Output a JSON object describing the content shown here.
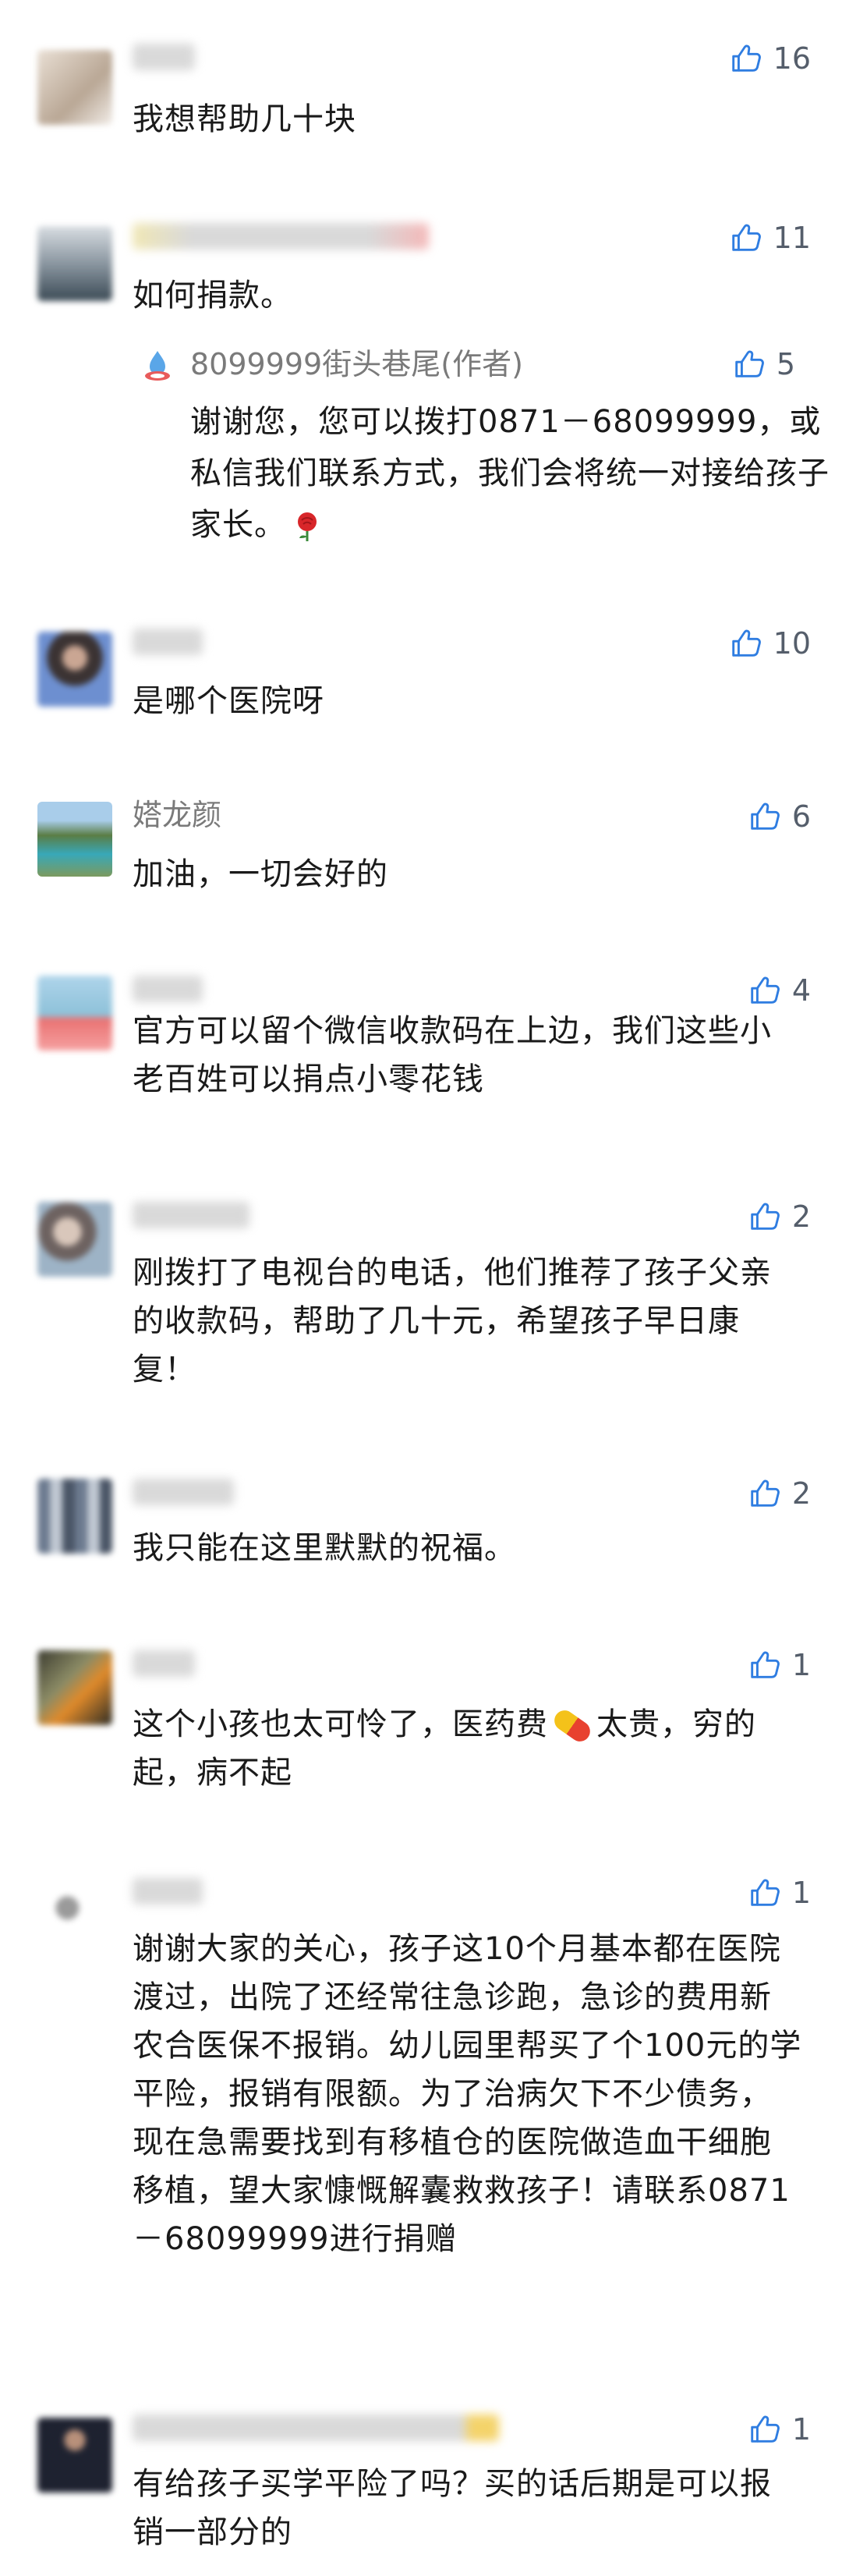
{
  "comments": [
    {
      "text": "我想帮助几十块",
      "likes": "16"
    },
    {
      "text": "如何捐款。",
      "likes": "11",
      "reply": {
        "author": "8099999街头巷尾(作者)",
        "likes": "5",
        "text": "谢谢您，您可以拨打0871－68099999，或私信我们联系方式，我们会将统一对接给孩子家长。",
        "emoji": "rose"
      }
    },
    {
      "text": "是哪个医院呀",
      "likes": "10"
    },
    {
      "nickname": "㜓龙颜",
      "text": "加油，一切会好的",
      "likes": "6"
    },
    {
      "text": "官方可以留个微信收款码在上边，我们这些小老百姓可以捐点小零花钱",
      "likes": "4"
    },
    {
      "text": "刚拨打了电视台的电话，他们推荐了孩子父亲的收款码，帮助了几十元，希望孩子早日康复！",
      "likes": "2"
    },
    {
      "text": "我只能在这里默默的祝福。",
      "likes": "2"
    },
    {
      "text_a": "这个小孩也太可怜了，医药费",
      "text_b": "太贵，穷的起，病不起",
      "likes": "1"
    },
    {
      "text": "谢谢大家的关心，孩子这10个月基本都在医院渡过，出院了还经常往急诊跑，急诊的费用新农合医保不报销。幼儿园里帮买了个100元的学平险，报销有限额。为了治病欠下不少债务，现在急需要找到有移植仓的医院做造血干细胞移植，望大家慷慨解囊救救孩子！请联系0871－68099999进行捐赠",
      "likes": "1"
    },
    {
      "text": "有给孩子买学平险了吗？买的话后期是可以报销一部分的",
      "likes": "1"
    }
  ],
  "icons": {
    "like": "thumbs-up-icon",
    "reply_author": "water-drop-logo-icon",
    "rose": "rose-icon",
    "pill": "pill-icon"
  },
  "colors": {
    "like_icon": "#2f7de1",
    "meta_text": "#7a7a7a",
    "body_text": "#1a1a1a"
  }
}
